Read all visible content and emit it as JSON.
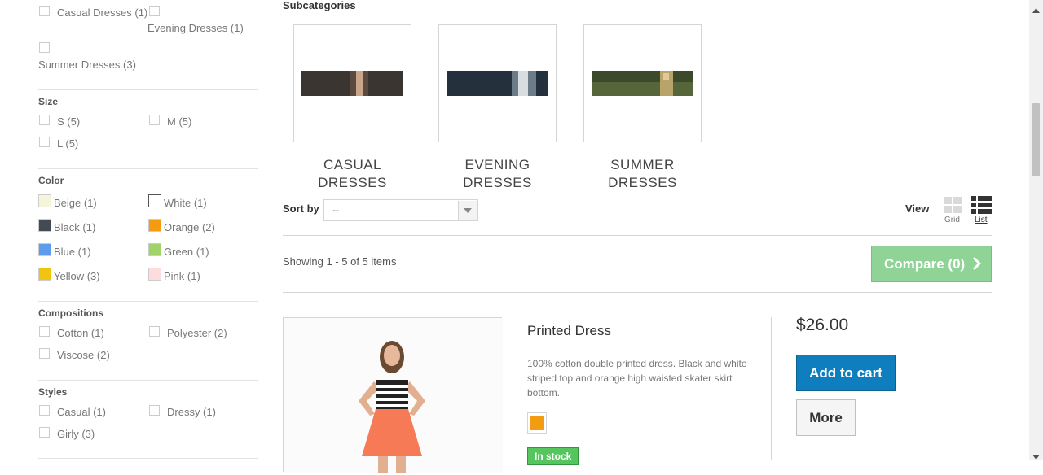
{
  "filters": {
    "categories": [
      {
        "label": "Casual Dresses (1)"
      },
      {
        "label": "Evening Dresses (1)"
      },
      {
        "label": "Summer Dresses (3)"
      }
    ],
    "size": {
      "title": "Size",
      "items": [
        {
          "label": "S (5)"
        },
        {
          "label": "M (5)"
        },
        {
          "label": "L (5)"
        }
      ]
    },
    "color": {
      "title": "Color",
      "items": [
        {
          "label": "Beige (1)",
          "color": "#f5f5dc"
        },
        {
          "label": "White (1)",
          "color": "#ffffff"
        },
        {
          "label": "Black (1)",
          "color": "#434a54"
        },
        {
          "label": "Orange (2)",
          "color": "#f39c11"
        },
        {
          "label": "Blue (1)",
          "color": "#5d9cec"
        },
        {
          "label": "Green (1)",
          "color": "#a0d468"
        },
        {
          "label": "Yellow (3)",
          "color": "#f1c40f"
        },
        {
          "label": "Pink (1)",
          "color": "#fcdcdc"
        }
      ]
    },
    "compositions": {
      "title": "Compositions",
      "items": [
        {
          "label": "Cotton (1)"
        },
        {
          "label": "Polyester (2)"
        },
        {
          "label": "Viscose (2)"
        }
      ]
    },
    "styles": {
      "title": "Styles",
      "items": [
        {
          "label": "Casual (1)"
        },
        {
          "label": "Dressy (1)"
        },
        {
          "label": "Girly (3)"
        }
      ]
    }
  },
  "subcategories": {
    "title": "Subcategories",
    "items": [
      {
        "name_line1": "CASUAL",
        "name_line2": "DRESSES"
      },
      {
        "name_line1": "EVENING",
        "name_line2": "DRESSES"
      },
      {
        "name_line1": "SUMMER",
        "name_line2": "DRESSES"
      }
    ]
  },
  "toolbar": {
    "sort_label": "Sort by",
    "sort_value": "--",
    "view_label": "View",
    "grid_label": "Grid",
    "list_label": "List",
    "showing": "Showing 1 - 5 of 5 items",
    "compare_label": "Compare (0)"
  },
  "product": {
    "name": "Printed Dress",
    "description": "100% cotton double printed dress. Black and white striped top and orange high waisted skater skirt bottom.",
    "price": "$26.00",
    "add_to_cart": "Add to cart",
    "more": "More",
    "stock": "In stock",
    "swatch_color": "#f39c11"
  },
  "colors": {
    "compare_bg": "#8fd396",
    "cart_bg": "#0f7ebf",
    "stock_bg": "#55c65e"
  }
}
